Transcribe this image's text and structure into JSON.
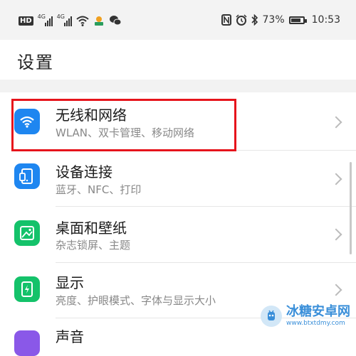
{
  "status_bar": {
    "hd_label": "HD",
    "sim1_label": "4G",
    "sim2_label": "4G",
    "battery_percent": "73%",
    "time": "10:53",
    "icons": [
      "hd-icon",
      "signal-icon",
      "signal-icon",
      "wifi-icon",
      "app-notification-icon",
      "wechat-icon",
      "nfc-icon",
      "alarm-icon",
      "bluetooth-icon",
      "battery-icon"
    ]
  },
  "page": {
    "title": "设置"
  },
  "settings_items": [
    {
      "title": "无线和网络",
      "subtitle": "WLAN、双卡管理、移动网络",
      "icon": "wifi-icon",
      "icon_color": "#1e86f0"
    },
    {
      "title": "设备连接",
      "subtitle": "蓝牙、NFC、打印",
      "icon": "device-connection-icon",
      "icon_color": "#1e86f0"
    },
    {
      "title": "桌面和壁纸",
      "subtitle": "杂志锁屏、主题",
      "icon": "wallpaper-icon",
      "icon_color": "#14c26a"
    },
    {
      "title": "显示",
      "subtitle": "亮度、护眼模式、字体与显示大小",
      "icon": "display-icon",
      "icon_color": "#14c26a"
    },
    {
      "title": "声音",
      "subtitle": "",
      "icon": "sound-icon",
      "icon_color": "#8a58e8"
    }
  ],
  "highlight_color": "#e6141c",
  "watermark": {
    "name": "冰糖安卓网",
    "url": "www.btxtdmy.com"
  }
}
